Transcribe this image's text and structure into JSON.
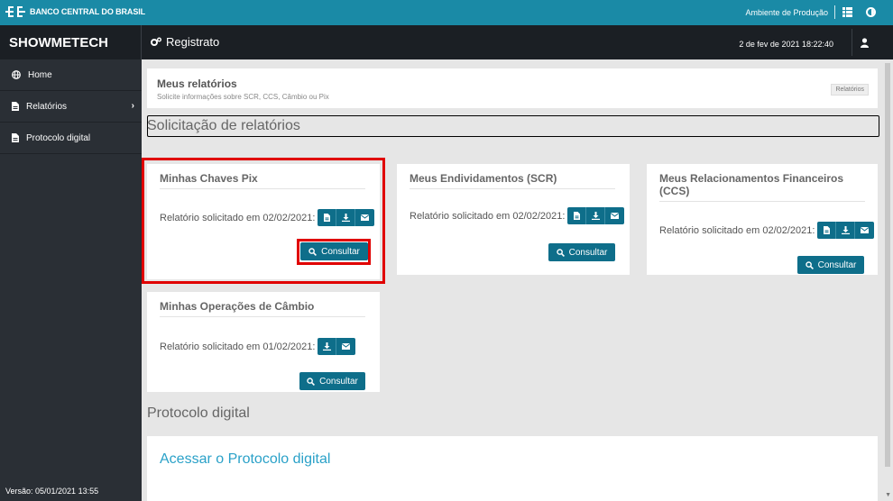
{
  "topbar": {
    "org_name": "BANCO CENTRAL DO BRASIL",
    "environment": "Ambiente de Produção"
  },
  "header": {
    "brand": "SHOWMETECH",
    "title": "Registrato",
    "datetime": "2 de fev de 2021 18:22:40"
  },
  "sidebar": {
    "items": [
      {
        "label": "Home",
        "icon": "globe-icon"
      },
      {
        "label": "Relatórios",
        "icon": "document-icon"
      },
      {
        "label": "Protocolo digital",
        "icon": "document-icon"
      }
    ],
    "version": "Versão:  05/01/2021 13:55"
  },
  "breadcrumb": {
    "title": "Meus relatórios",
    "subtitle": "Solicite informações sobre SCR, CCS, Câmbio ou Pix",
    "badge": "Relatórios"
  },
  "section_title": "Solicitação de relatórios",
  "cards": [
    {
      "title": "Minhas Chaves Pix",
      "request_text": "Relatório solicitado em 02/02/2021:",
      "button": "Consultar"
    },
    {
      "title": "Meus Endividamentos (SCR)",
      "request_text": "Relatório solicitado em 02/02/2021:",
      "button": "Consultar"
    },
    {
      "title": "Meus Relacionamentos Financeiros (CCS)",
      "request_text": "Relatório solicitado em 02/02/2021:",
      "button": "Consultar"
    },
    {
      "title": "Minhas Operações de Câmbio",
      "request_text": "Relatório solicitado em 01/02/2021:",
      "button": "Consultar"
    }
  ],
  "protocol": {
    "section_title": "Protocolo digital",
    "link": "Acessar o Protocolo digital"
  },
  "colors": {
    "topbar": "#1a8aa6",
    "header": "#1b1f24",
    "sidebar": "#2a2f35",
    "primary_button": "#0e6e8a",
    "link": "#2aa1c8",
    "highlight": "#e00000"
  }
}
